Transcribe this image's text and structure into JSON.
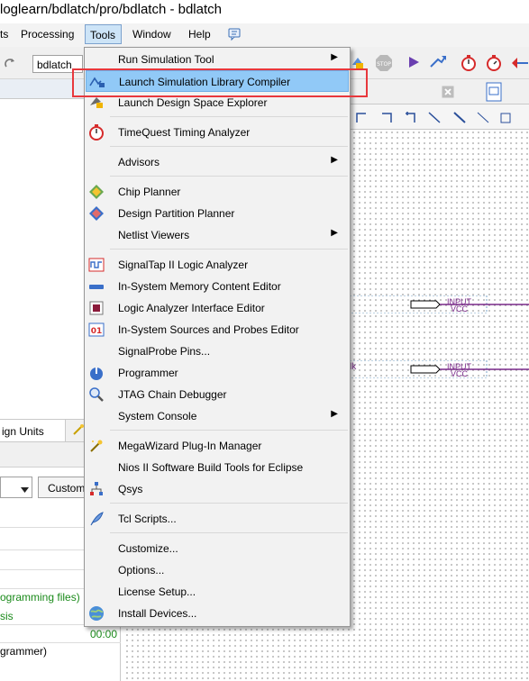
{
  "window": {
    "title": "loglearn/bdlatch/pro/bdlatch - bdlatch"
  },
  "menubar": {
    "items": [
      {
        "label": "ts"
      },
      {
        "label": "Processing"
      },
      {
        "label": "Tools"
      },
      {
        "label": "Window"
      },
      {
        "label": "Help"
      }
    ]
  },
  "toolbar": {
    "entity_combo": "bdlatch"
  },
  "tools_menu": {
    "items": [
      {
        "label": "Run Simulation Tool",
        "submenu": true
      },
      {
        "label": "Launch Simulation Library Compiler",
        "highlighted": true
      },
      {
        "label": "Launch Design Space Explorer"
      },
      {
        "label": "TimeQuest Timing Analyzer"
      },
      {
        "label": "Advisors",
        "submenu": true
      },
      {
        "label": "Chip Planner"
      },
      {
        "label": "Design Partition Planner"
      },
      {
        "label": "Netlist Viewers",
        "submenu": true
      },
      {
        "label": "SignalTap II Logic Analyzer"
      },
      {
        "label": "In-System Memory Content Editor"
      },
      {
        "label": "Logic Analyzer Interface Editor"
      },
      {
        "label": "In-System Sources and Probes Editor"
      },
      {
        "label": "SignalProbe Pins..."
      },
      {
        "label": "Programmer"
      },
      {
        "label": "JTAG Chain Debugger"
      },
      {
        "label": "System Console",
        "submenu": true
      },
      {
        "label": "MegaWizard Plug-In Manager"
      },
      {
        "label": "Nios II Software Build Tools for Eclipse"
      },
      {
        "label": "Qsys"
      },
      {
        "label": "Tcl Scripts..."
      },
      {
        "label": "Customize..."
      },
      {
        "label": "Options..."
      },
      {
        "label": "License Setup..."
      },
      {
        "label": "Install Devices..."
      }
    ],
    "submenu_arrow": "▶"
  },
  "left_panel": {
    "tab_label": "ign Units",
    "custom_button": "Custom",
    "rows": [
      {
        "text": "ogramming files)",
        "color": "#1a8a1a"
      },
      {
        "text": "sis",
        "color": "#1a8a1a"
      },
      {
        "text": "00:00",
        "color": "#1a8a1a"
      },
      {
        "text": "grammer)",
        "color": "#000000"
      }
    ]
  },
  "canvas": {
    "pins": [
      {
        "type": "INPUT",
        "sub": "VCC"
      },
      {
        "type": "INPUT",
        "sub": "VCC",
        "side": "lk"
      }
    ]
  },
  "colors": {
    "highlight": "#91c9f7",
    "callout": "#e8383d",
    "menu_bg": "#f2f2f2",
    "pin_text": "#7a2a8a"
  }
}
